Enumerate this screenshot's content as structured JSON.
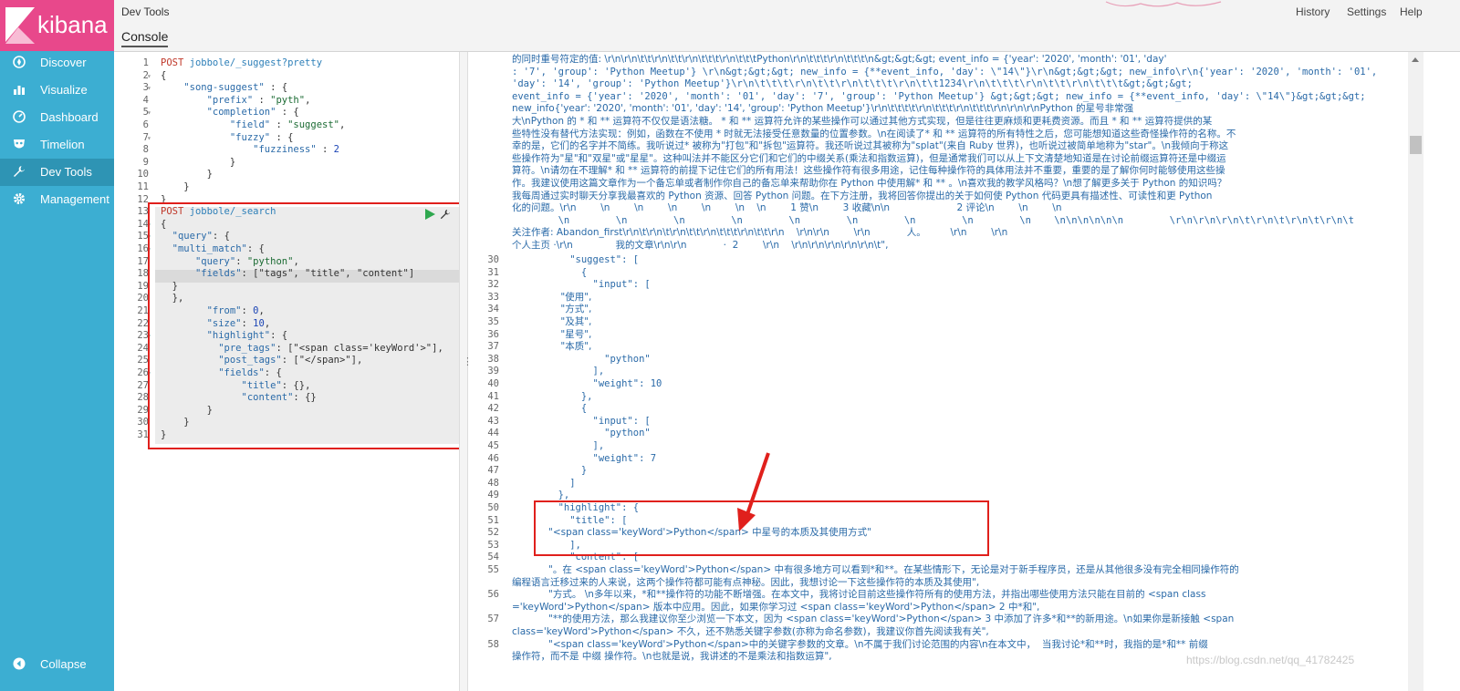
{
  "sidebar": {
    "brand": "kibana",
    "items": [
      {
        "label": "Discover",
        "icon": "compass-icon"
      },
      {
        "label": "Visualize",
        "icon": "bar-chart-icon"
      },
      {
        "label": "Dashboard",
        "icon": "dashboard-gauge-icon"
      },
      {
        "label": "Timelion",
        "icon": "timelion-mask-icon"
      },
      {
        "label": "Dev Tools",
        "icon": "wrench-icon",
        "active": true
      },
      {
        "label": "Management",
        "icon": "gear-icon"
      }
    ],
    "collapse_label": "Collapse"
  },
  "header": {
    "title": "Dev Tools",
    "tab": "Console",
    "links": [
      "History",
      "Settings",
      "Help"
    ]
  },
  "input_editor": {
    "lines": [
      "POST jobbole/_suggest?pretty",
      "{",
      "    \"song-suggest\" : {",
      "        \"prefix\" : \"pyth\",",
      "        \"completion\" : {",
      "            \"field\" : \"suggest\",",
      "            \"fuzzy\" : {",
      "                \"fuzziness\" : 2",
      "            }",
      "        }",
      "    }",
      "}",
      "POST jobbole/_search",
      "{",
      "  \"query\": {",
      "  \"multi_match\": {",
      "      \"query\": \"python\",",
      "      \"fields\": [\"tags\", \"title\", \"content\"]",
      "  }",
      "  },",
      "        \"from\": 0,",
      "        \"size\": 10,",
      "        \"highlight\": {",
      "          \"pre_tags\": [\"<span class='keyWord'>\"],",
      "          \"post_tags\": [\"</span>\"],",
      "          \"fields\": {",
      "              \"title\": {},",
      "              \"content\": {}",
      "        }",
      "    }",
      "}"
    ]
  },
  "output_editor": {
    "wrapped_lines": [
      "的同时重号符定的值: \\r\\n\\r\\n\\t\\t\\r\\n\\t\\t\\r\\n\\t\\t\\t\\r\\n\\t\\t\\tPython\\r\\n\\t\\t\\t\\r\\n\\t\\t\\t\\n&gt;&gt;&gt; event_info = {'year': '2020', 'month': '01', 'day'",
      ": '7', 'group': 'Python Meetup'} \\r\\n&gt;&gt;&gt; new_info = {**event_info, 'day': \\\"14\\\"}\\r\\n&gt;&gt;&gt; new_info\\r\\n{'year': '2020', 'month': '01',",
      "'day': '14', 'group': 'Python Meetup'}\\r\\n\\t\\t\\t\\r\\n\\t\\t\\r\\n\\t\\t\\t\\r\\n\\t\\t1234\\r\\n\\t\\t\\t\\r\\n\\t\\t\\r\\n\\t\\t\\t&gt;&gt;&gt;",
      "event_info = {'year': '2020', 'month': '01', 'day': '7', 'group': 'Python Meetup'} &gt;&gt;&gt; new_info = {**event_info, 'day': \\\"14\\\"}&gt;&gt;&gt;",
      "new_info{'year': '2020', 'month': '01', 'day': '14', 'group': 'Python Meetup'}\\r\\n\\t\\t\\t\\t\\r\\n\\t\\t\\t\\r\\n\\t\\t\\t\\r\\n\\r\\n\\r\\nPython 的星号非常强",
      "大\\nPython 的 * 和 ** 运算符不仅仅是语法糖。 * 和 ** 运算符允许的某些操作可以通过其他方式实现，但是往往更麻烦和更耗费资源。而且 * 和 ** 运算符提供的某",
      "些特性没有替代方法实现：例如，函数在不使用 * 时就无法接受任意数量的位置参数。\\n在阅读了* 和 ** 运算符的所有特性之后，您可能想知道这些奇怪操作符的名称。不",
      "幸的是，它们的名字并不简练。我听说过* 被称为\"打包\"和\"拆包\"运算符。我还听说过其被称为\"splat\"(来自 Ruby 世界)，也听说过被简单地称为\"star\"。\\n我倾向于称这",
      "些操作符为\"星\"和\"双星\"或\"星星\"。这种叫法并不能区分它们和它们的中缀关系(乘法和指数运算)，但是通常我们可以从上下文清楚地知道是在讨论前缀运算符还是中缀运",
      "算符。\\n请勿在不理解* 和 ** 运算符的前提下记住它们的所有用法！这些操作符有很多用途，记住每种操作符的具体用法并不重要，重要的是了解你何时能够使用这些操",
      "作。我建议使用这篇文章作为一个备忘单或者制作你自己的备忘单来帮助你在 Python 中使用解* 和 ** 。\\n喜欢我的教学风格吗？\\n想了解更多关于 Python 的知识吗？",
      "我每周通过实时聊天分享我最喜欢的 Python 资源、回答 Python 问题。在下方注册，我将回答你提出的关于如何使 Python 代码更具有描述性、可读性和更 Python",
      "化的问题。\\r\\n        \\n        \\n        \\n        \\n        \\n    \\n        1 赞\\n        3 收藏\\n\\n                      2 评论\\n        \\n        \\n",
      "        \\n        \\n        \\n        \\n        \\n        \\n        \\n        \\n        \\n    \\n\\n\\n\\n\\n\\n        \\r\\n\\r\\n\\r\\n\\t\\r\\n\\t\\r\\n\\t\\r\\n\\t",
      "关注作者: Abandon_first\\r\\n\\t\\r\\n\\t\\r\\n\\t\\t\\r\\n\\t\\t\\t\\r\\n\\t\\t\\r\\n    \\r\\n\\r\\n        \\r\\n            人。        \\r\\n        \\r\\n",
      "个人主页 ·\\r\\n              我的文章\\r\\n\\r\\n            ·  2        \\r\\n    \\r\\n\\r\\n\\r\\n\\r\\n\\r\\n\\t\","
    ],
    "numbered_lines": [
      {
        "n": "30",
        "text": "          \"suggest\": ["
      },
      {
        "n": "31",
        "text": "            {"
      },
      {
        "n": "32",
        "text": "              \"input\": ["
      },
      {
        "n": "33",
        "text": "                \"使用\","
      },
      {
        "n": "34",
        "text": "                \"方式\","
      },
      {
        "n": "35",
        "text": "                \"及其\","
      },
      {
        "n": "36",
        "text": "                \"星号\","
      },
      {
        "n": "37",
        "text": "                \"本质\","
      },
      {
        "n": "38",
        "text": "                \"python\""
      },
      {
        "n": "39",
        "text": "              ],"
      },
      {
        "n": "40",
        "text": "              \"weight\": 10"
      },
      {
        "n": "41",
        "text": "            },"
      },
      {
        "n": "42",
        "text": "            {"
      },
      {
        "n": "43",
        "text": "              \"input\": ["
      },
      {
        "n": "44",
        "text": "                \"python\""
      },
      {
        "n": "45",
        "text": "              ],"
      },
      {
        "n": "46",
        "text": "              \"weight\": 7"
      },
      {
        "n": "47",
        "text": "            }"
      },
      {
        "n": "48",
        "text": "          ]"
      },
      {
        "n": "49",
        "text": "        },"
      },
      {
        "n": "50",
        "text": "        \"highlight\": {"
      },
      {
        "n": "51",
        "text": "          \"title\": ["
      },
      {
        "n": "52",
        "text": "            \"<span class='keyWord'>Python</span> 中星号的本质及其使用方式\""
      },
      {
        "n": "53",
        "text": "          ],"
      },
      {
        "n": "54",
        "text": "          \"content\": ["
      },
      {
        "n": "55",
        "text": "            \"。在 <span class='keyWord'>Python</span> 中有很多地方可以看到*和**。在某些情形下，无论是对于新手程序员，还是从其他很多没有完全相同操作符的"
      },
      {
        "n": "",
        "text": "编程语言迁移过来的人来说，这两个操作符都可能有点神秘。因此，我想讨论一下这些操作符的本质及其使用\","
      },
      {
        "n": "56",
        "text": "            \"方式。 \\n多年以来，*和**操作符的功能不断增强。在本文中，我将讨论目前这些操作符所有的使用方法，并指出哪些使用方法只能在目前的 <span class"
      },
      {
        "n": "",
        "text": "='keyWord'>Python</span> 版本中应用。因此，如果你学习过 <span class='keyWord'>Python</span> 2 中*和\","
      },
      {
        "n": "57",
        "text": "            \"**的使用方法，那么我建议你至少浏览一下本文，因为 <span class='keyWord'>Python</span> 3 中添加了许多*和**的新用途。\\n如果你是新接触 <span"
      },
      {
        "n": "",
        "text": "class='keyWord'>Python</span> 不久，还不熟悉关键字参数(亦称为命名参数)，我建议你首先阅读我有关\","
      },
      {
        "n": "58",
        "text": "            \"<span class='keyWord'>Python</span>中的关键字参数的文章。\\n不属于我们讨论范围的内容\\n在本文中，  当我讨论*和**时，我指的是*和** 前缀"
      },
      {
        "n": "",
        "text": "操作符，而不是 中缀 操作符。\\n也就是说，我讲述的不是乘法和指数运算\","
      }
    ]
  },
  "watermark": "https://blog.csdn.net/qq_41782425"
}
